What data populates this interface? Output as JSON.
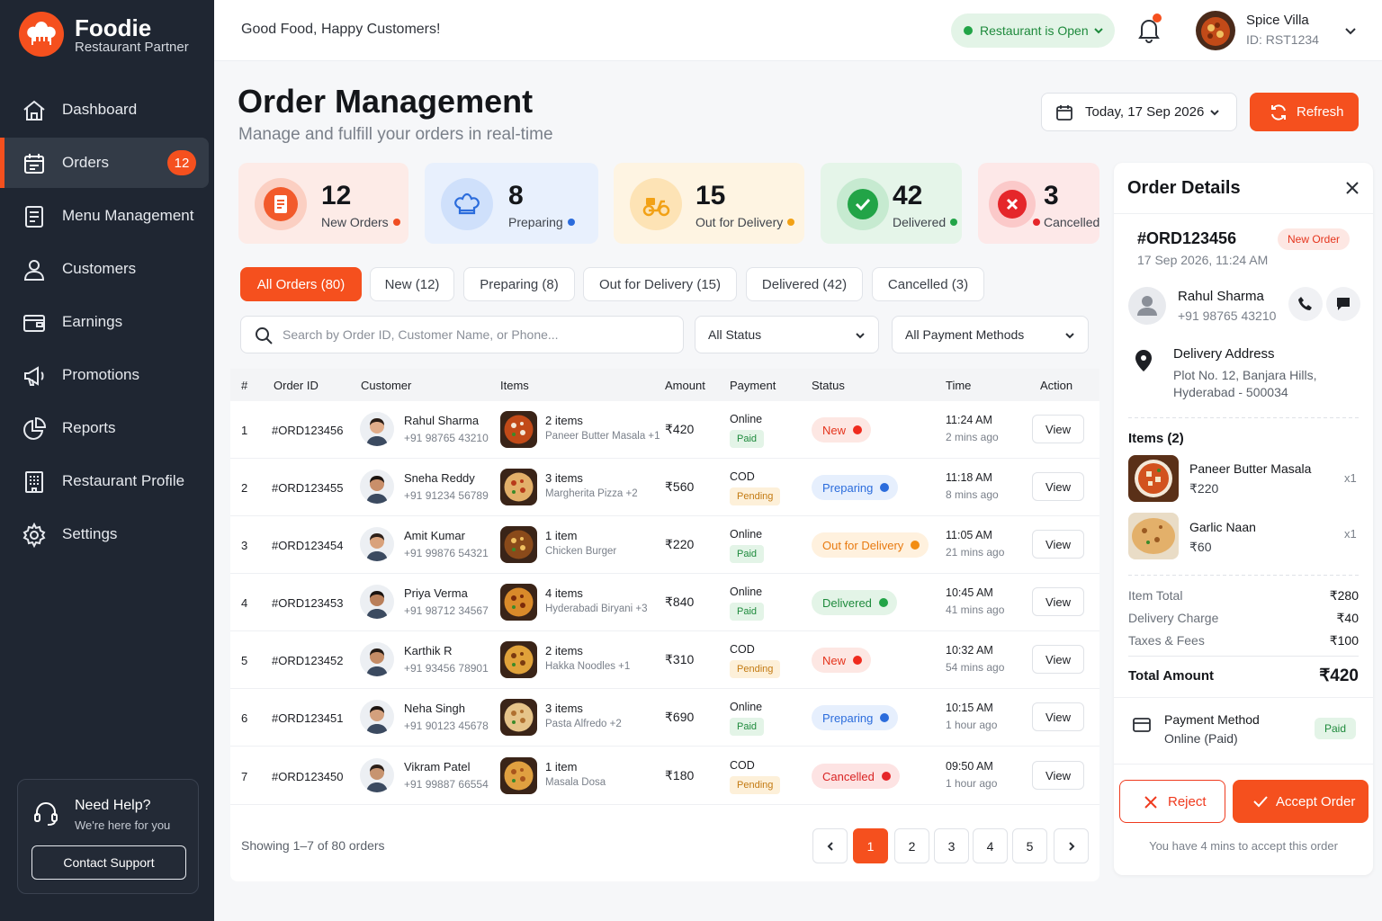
{
  "brand": {
    "name": "Foodie",
    "subtitle": "Restaurant Partner"
  },
  "sidebar": {
    "items": [
      {
        "label": "Dashboard",
        "icon": "home-icon"
      },
      {
        "label": "Orders",
        "icon": "orders-icon",
        "badge": "12",
        "active": true
      },
      {
        "label": "Menu Management",
        "icon": "menu-icon"
      },
      {
        "label": "Customers",
        "icon": "user-icon"
      },
      {
        "label": "Earnings",
        "icon": "wallet-icon"
      },
      {
        "label": "Promotions",
        "icon": "megaphone-icon"
      },
      {
        "label": "Reports",
        "icon": "pie-chart-icon"
      },
      {
        "label": "Restaurant Profile",
        "icon": "building-icon"
      },
      {
        "label": "Settings",
        "icon": "gear-icon"
      }
    ],
    "help": {
      "title": "Need Help?",
      "subtitle": "We're here for you",
      "button": "Contact Support"
    }
  },
  "topbar": {
    "tagline": "Good Food, Happy Customers!",
    "status": "Restaurant is Open",
    "restaurant_name": "Spice Villa",
    "restaurant_id": "ID: RST1234"
  },
  "header": {
    "title": "Order Management",
    "subtitle": "Manage and fulfill your orders in real-time",
    "date": "Today, 17 Sep 2026",
    "refresh": "Refresh"
  },
  "stats": [
    {
      "value": "12",
      "label": "New Orders",
      "color": "#f04e23",
      "bg": "#fdebe7"
    },
    {
      "value": "8",
      "label": "Preparing",
      "color": "#2b6cdc",
      "bg": "#e8f0fd"
    },
    {
      "value": "15",
      "label": "Out for Delivery",
      "color": "#f2a115",
      "bg": "#fef4e2"
    },
    {
      "value": "42",
      "label": "Delivered",
      "color": "#22a447",
      "bg": "#e5f5e9"
    },
    {
      "value": "3",
      "label": "Cancelled",
      "color": "#e5262a",
      "bg": "#fde8e8"
    }
  ],
  "tabs": [
    "All Orders (80)",
    "New (12)",
    "Preparing (8)",
    "Out for Delivery (15)",
    "Delivered (42)",
    "Cancelled (3)"
  ],
  "filters": {
    "search_placeholder": "Search by Order ID, Customer Name, or Phone...",
    "status": "All Status",
    "payment": "All Payment Methods"
  },
  "table": {
    "columns": [
      "#",
      "Order ID",
      "Customer",
      "Items",
      "Amount",
      "Payment",
      "Status",
      "Time",
      "Action"
    ],
    "rows": [
      {
        "n": "1",
        "id": "#ORD123456",
        "name": "Rahul Sharma",
        "phone": "+91 98765 43210",
        "items": "2 items",
        "items_detail": "Paneer Butter Masala +1",
        "amount": "₹420",
        "pay": "Online",
        "pay_status": "Paid",
        "status": "New",
        "time": "11:24 AM",
        "ago": "2 mins ago",
        "action": "View"
      },
      {
        "n": "2",
        "id": "#ORD123455",
        "name": "Sneha Reddy",
        "phone": "+91 91234 56789",
        "items": "3 items",
        "items_detail": "Margherita Pizza +2",
        "amount": "₹560",
        "pay": "COD",
        "pay_status": "Pending",
        "status": "Preparing",
        "time": "11:18 AM",
        "ago": "8 mins ago",
        "action": "View"
      },
      {
        "n": "3",
        "id": "#ORD123454",
        "name": "Amit Kumar",
        "phone": "+91 99876 54321",
        "items": "1 item",
        "items_detail": "Chicken Burger",
        "amount": "₹220",
        "pay": "Online",
        "pay_status": "Paid",
        "status": "Out for Delivery",
        "time": "11:05 AM",
        "ago": "21 mins ago",
        "action": "View"
      },
      {
        "n": "4",
        "id": "#ORD123453",
        "name": "Priya Verma",
        "phone": "+91 98712 34567",
        "items": "4 items",
        "items_detail": "Hyderabadi Biryani +3",
        "amount": "₹840",
        "pay": "Online",
        "pay_status": "Paid",
        "status": "Delivered",
        "time": "10:45 AM",
        "ago": "41 mins ago",
        "action": "View"
      },
      {
        "n": "5",
        "id": "#ORD123452",
        "name": "Karthik R",
        "phone": "+91 93456 78901",
        "items": "2 items",
        "items_detail": "Hakka Noodles +1",
        "amount": "₹310",
        "pay": "COD",
        "pay_status": "Pending",
        "status": "New",
        "time": "10:32 AM",
        "ago": "54 mins ago",
        "action": "View"
      },
      {
        "n": "6",
        "id": "#ORD123451",
        "name": "Neha Singh",
        "phone": "+91 90123 45678",
        "items": "3 items",
        "items_detail": "Pasta Alfredo +2",
        "amount": "₹690",
        "pay": "Online",
        "pay_status": "Paid",
        "status": "Preparing",
        "time": "10:15 AM",
        "ago": "1 hour ago",
        "action": "View"
      },
      {
        "n": "7",
        "id": "#ORD123450",
        "name": "Vikram Patel",
        "phone": "+91 99887 66554",
        "items": "1 item",
        "items_detail": "Masala Dosa",
        "amount": "₹180",
        "pay": "COD",
        "pay_status": "Pending",
        "status": "Cancelled",
        "time": "09:50 AM",
        "ago": "1 hour ago",
        "action": "View"
      }
    ],
    "showing": "Showing 1–7 of 80 orders",
    "pages": [
      "1",
      "2",
      "3",
      "4",
      "5"
    ],
    "current_page": "1"
  },
  "details": {
    "title": "Order Details",
    "order_id": "#ORD123456",
    "badge": "New Order",
    "datetime": "17 Sep 2026, 11:24 AM",
    "customer": {
      "name": "Rahul Sharma",
      "phone": "+91 98765 43210"
    },
    "address_title": "Delivery Address",
    "address": "Plot No. 12, Banjara Hills, Hyderabad - 500034",
    "items_title": "Items (2)",
    "items": [
      {
        "name": "Paneer Butter Masala",
        "price": "₹220",
        "qty": "x1"
      },
      {
        "name": "Garlic Naan",
        "price": "₹60",
        "qty": "x1"
      }
    ],
    "summary": [
      {
        "label": "Item Total",
        "value": "₹280"
      },
      {
        "label": "Delivery Charge",
        "value": "₹40"
      },
      {
        "label": "Taxes & Fees",
        "value": "₹100"
      }
    ],
    "total_label": "Total Amount",
    "total_value": "₹420",
    "payment_title": "Payment Method",
    "payment_value": "Online (Paid)",
    "payment_badge": "Paid",
    "reject": "Reject",
    "accept": "Accept Order",
    "note": "You have 4 mins to accept this order"
  }
}
